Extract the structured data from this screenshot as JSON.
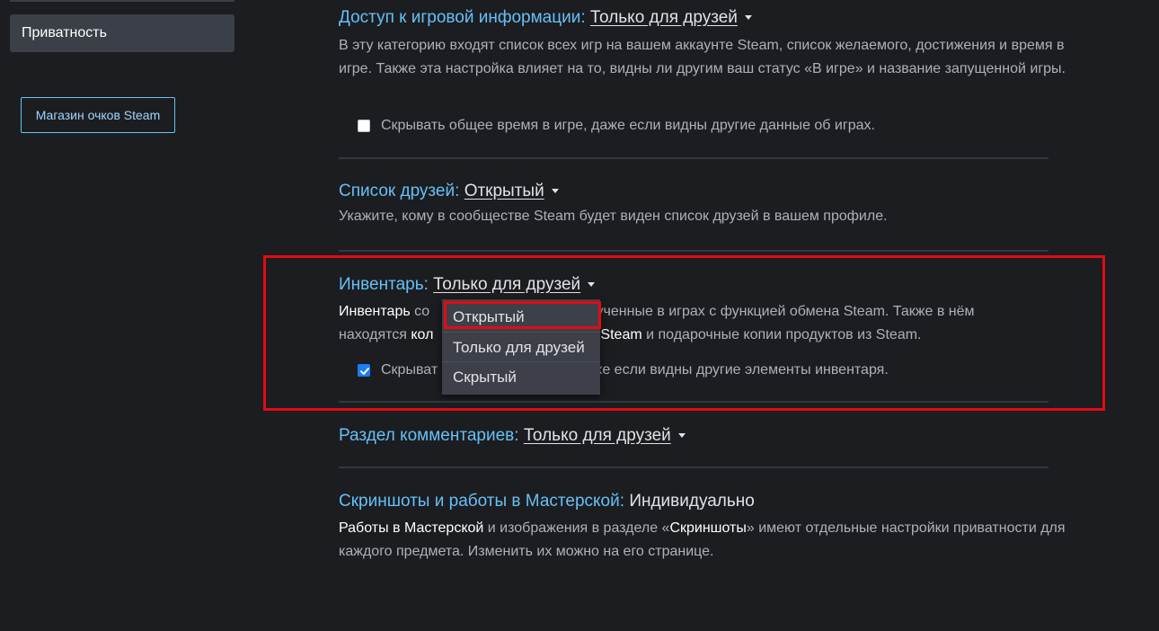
{
  "sidebar": {
    "selected_item": "Приватность",
    "points_shop_button": "Магазин очков Steam"
  },
  "sections": {
    "game_details": {
      "label": "Доступ к игровой информации:",
      "value": "Только для друзей",
      "desc": "В эту категорию входят список всех игр на вашем аккаунте Steam, список желаемого, достижения и время в игре. Также эта настройка влияет на то, видны ли другим ваш статус «В игре» и название запущенной игры.",
      "checkbox_label": "Скрывать общее время в игре, даже если видны другие данные об играх.",
      "checkbox_checked": false
    },
    "friends_list": {
      "label": "Список друзей:",
      "value": "Открытый",
      "desc": "Укажите, кому в сообществе Steam будет виден список друзей в вашем профиле."
    },
    "inventory": {
      "label": "Инвентарь:",
      "value": "Только для друзей",
      "desc_bold1": "Инвентарь",
      "desc_part1": " со",
      "desc_part2": "лученные в играх с функцией обмена Steam. Также в нём",
      "desc_part3": "находятся ",
      "desc_bold2": "кол",
      "desc_bold3": "Steam",
      "desc_part4": " и подарочные копии продуктов из Steam.",
      "checkbox_label_part1": "Скрыват",
      "checkbox_label_part2": "ке если видны другие элементы инвентаря.",
      "checkbox_checked": true
    },
    "comments": {
      "label": "Раздел комментариев:",
      "value": "Только для друзей"
    },
    "screenshots": {
      "label": "Скриншоты и работы в Мастерской:",
      "value": "Индивидуально",
      "desc_bold1": "Работы в Мастерской",
      "desc_part1": " и изображения в разделе «",
      "desc_bold2": "Скриншоты",
      "desc_part2": "» имеют отдельные настройки приватности для каждого предмета. Изменить их можно на его странице."
    }
  },
  "dropdown": {
    "options": [
      "Открытый",
      "Только для друзей",
      "Скрытый"
    ],
    "hovered": "Открытый"
  },
  "colors": {
    "background": "#1b1d21",
    "label_blue": "#66c0f4",
    "highlight_red": "#e30b13",
    "checkbox_blue": "#1a7ef2"
  }
}
